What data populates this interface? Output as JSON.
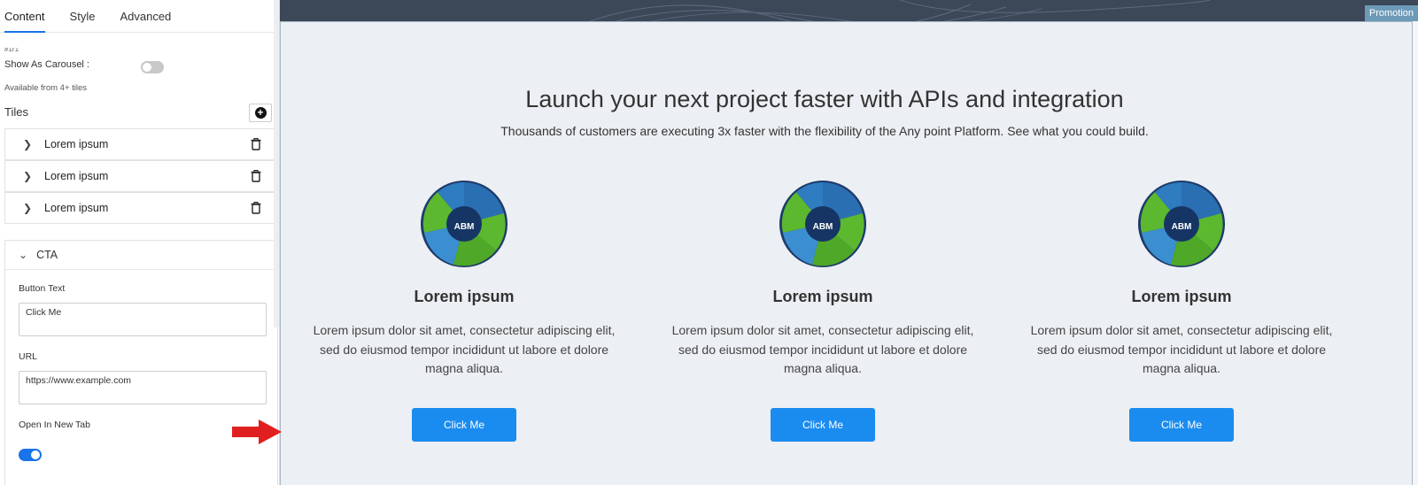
{
  "panel": {
    "tabs": [
      {
        "label": "Content",
        "active": true
      },
      {
        "label": "Style",
        "active": false
      },
      {
        "label": "Advanced",
        "active": false
      }
    ],
    "partial_text": "#1r1",
    "carousel_label": "Show As Carousel :",
    "carousel_enabled": false,
    "carousel_hint": "Available from 4+ tiles",
    "tiles_label": "Tiles",
    "tiles": [
      {
        "label": "Lorem ipsum"
      },
      {
        "label": "Lorem ipsum"
      },
      {
        "label": "Lorem ipsum"
      }
    ],
    "cta": {
      "section_label": "CTA",
      "button_text_label": "Button Text",
      "button_text_value": "Click Me",
      "url_label": "URL",
      "url_value": "https://www.example.com",
      "new_tab_label": "Open In New Tab",
      "new_tab_enabled": true
    }
  },
  "preview": {
    "promo_label": "Promotion",
    "headline": "Launch your next project faster with APIs and integration",
    "subheadline": "Thousands of customers are executing 3x faster with the flexibility of the Any point Platform. See what you could build.",
    "cards": [
      {
        "logo_text": "ABM",
        "title": "Lorem ipsum",
        "description": "Lorem ipsum dolor sit amet, consectetur adipiscing elit, sed do eiusmod tempor incididunt ut labore et dolore magna aliqua.",
        "button": "Click Me"
      },
      {
        "logo_text": "ABM",
        "title": "Lorem ipsum",
        "description": "Lorem ipsum dolor sit amet, consectetur adipiscing elit, sed do eiusmod tempor incididunt ut labore et dolore magna aliqua.",
        "button": "Click Me"
      },
      {
        "logo_text": "ABM",
        "title": "Lorem ipsum",
        "description": "Lorem ipsum dolor sit amet, consectetur adipiscing elit, sed do eiusmod tempor incididunt ut labore et dolore magna aliqua.",
        "button": "Click Me"
      }
    ]
  },
  "colors": {
    "accent": "#1a73e8",
    "button": "#1a8cf0",
    "banner": "#3c4758",
    "promo": "#6d9ab8",
    "annotation_arrow": "#e02020",
    "logo_blue": "#2b6fb3",
    "logo_green": "#5cb82e"
  },
  "icons": {
    "add": "add-circle-icon",
    "expand": "chevron-right-icon",
    "collapse": "chevron-down-icon",
    "delete": "trash-icon",
    "annotation": "arrow-right-icon"
  }
}
